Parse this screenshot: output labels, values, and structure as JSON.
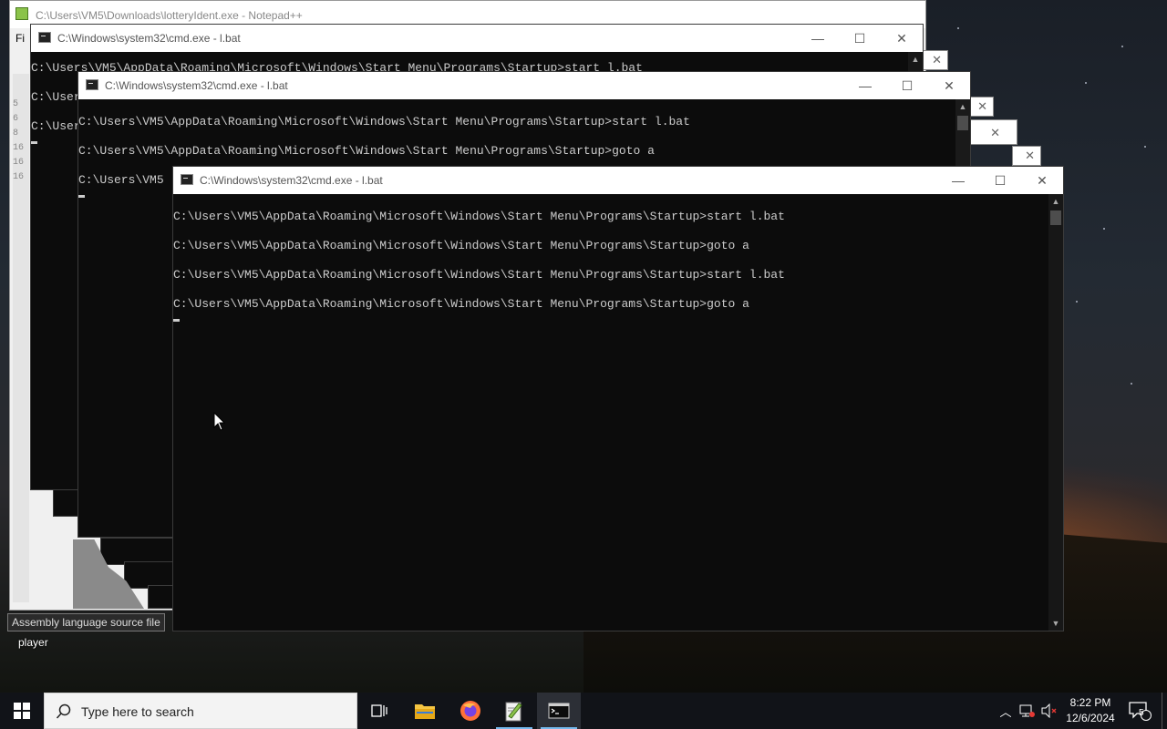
{
  "window_title": "C:\\Windows\\system32\\cmd.exe - l.bat",
  "back_window_title": "C:\\Users\\VM5\\Downloads\\lotteryIdent.exe - Notepad++",
  "front_console_lines": [
    "C:\\Users\\VM5\\AppData\\Roaming\\Microsoft\\Windows\\Start Menu\\Programs\\Startup>start l.bat",
    "C:\\Users\\VM5\\AppData\\Roaming\\Microsoft\\Windows\\Start Menu\\Programs\\Startup>goto a",
    "C:\\Users\\VM5\\AppData\\Roaming\\Microsoft\\Windows\\Start Menu\\Programs\\Startup>start l.bat",
    "C:\\Users\\VM5\\AppData\\Roaming\\Microsoft\\Windows\\Start Menu\\Programs\\Startup>goto a"
  ],
  "middle_console_lines": [
    "C:\\Users\\VM5\\AppData\\Roaming\\Microsoft\\Windows\\Start Menu\\Programs\\Startup>start l.bat",
    "C:\\Users\\VM5\\AppData\\Roaming\\Microsoft\\Windows\\Start Menu\\Programs\\Startup>goto a",
    "C:\\Users\\VM5"
  ],
  "back_console_lines": [
    "C:\\Users\\VM5\\AppData\\Roaming\\Microsoft\\Windows\\Start Menu\\Programs\\Startup>start l.bat",
    "C:\\Users",
    "C:\\Users"
  ],
  "notepad_menu": "Fi",
  "notepad_gutter": [
    "5",
    "6",
    "8",
    "16",
    "16",
    "16"
  ],
  "tooltip": "Assembly language source file",
  "desktop_label": "player",
  "taskbar": {
    "search_placeholder": "Type here to search",
    "clock_time": "8:22 PM",
    "clock_date": "12/6/2024",
    "notification_count": "5"
  },
  "icons": {
    "start": "windows-logo-icon",
    "search": "search-icon",
    "task_view": "task-view-icon",
    "file_explorer": "folder-icon",
    "firefox": "firefox-icon",
    "notepadpp": "notepadpp-icon",
    "cmd": "terminal-icon"
  },
  "colors": {
    "console_bg": "#0c0c0c",
    "console_text": "#cccccc",
    "taskbar": "#111318",
    "taskbar_accent": "#76b9ed"
  }
}
